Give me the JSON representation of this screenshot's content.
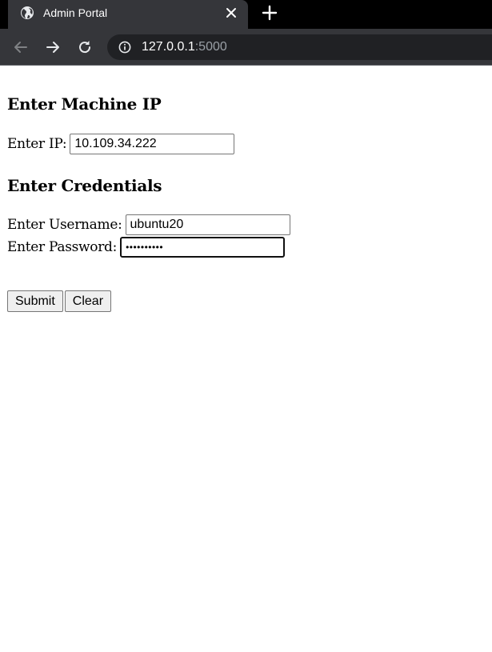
{
  "browser": {
    "tab_title": "Admin Portal",
    "url_host": "127.0.0.1",
    "url_port": ":5000",
    "icons": {
      "tab": "globe-icon",
      "close": "close-icon",
      "new_tab": "plus-icon",
      "back": "back-arrow-icon",
      "forward": "forward-arrow-icon",
      "reload": "reload-icon",
      "site_info": "info-icon"
    }
  },
  "page": {
    "machine_heading": "Enter Machine IP",
    "ip_label": "Enter IP:",
    "ip_value": "10.109.34.222",
    "credentials_heading": "Enter Credentials",
    "username_label": "Enter Username:",
    "username_value": "ubuntu20",
    "password_label": "Enter Password:",
    "password_value": "••••••••••",
    "submit_label": "Submit",
    "clear_label": "Clear"
  }
}
